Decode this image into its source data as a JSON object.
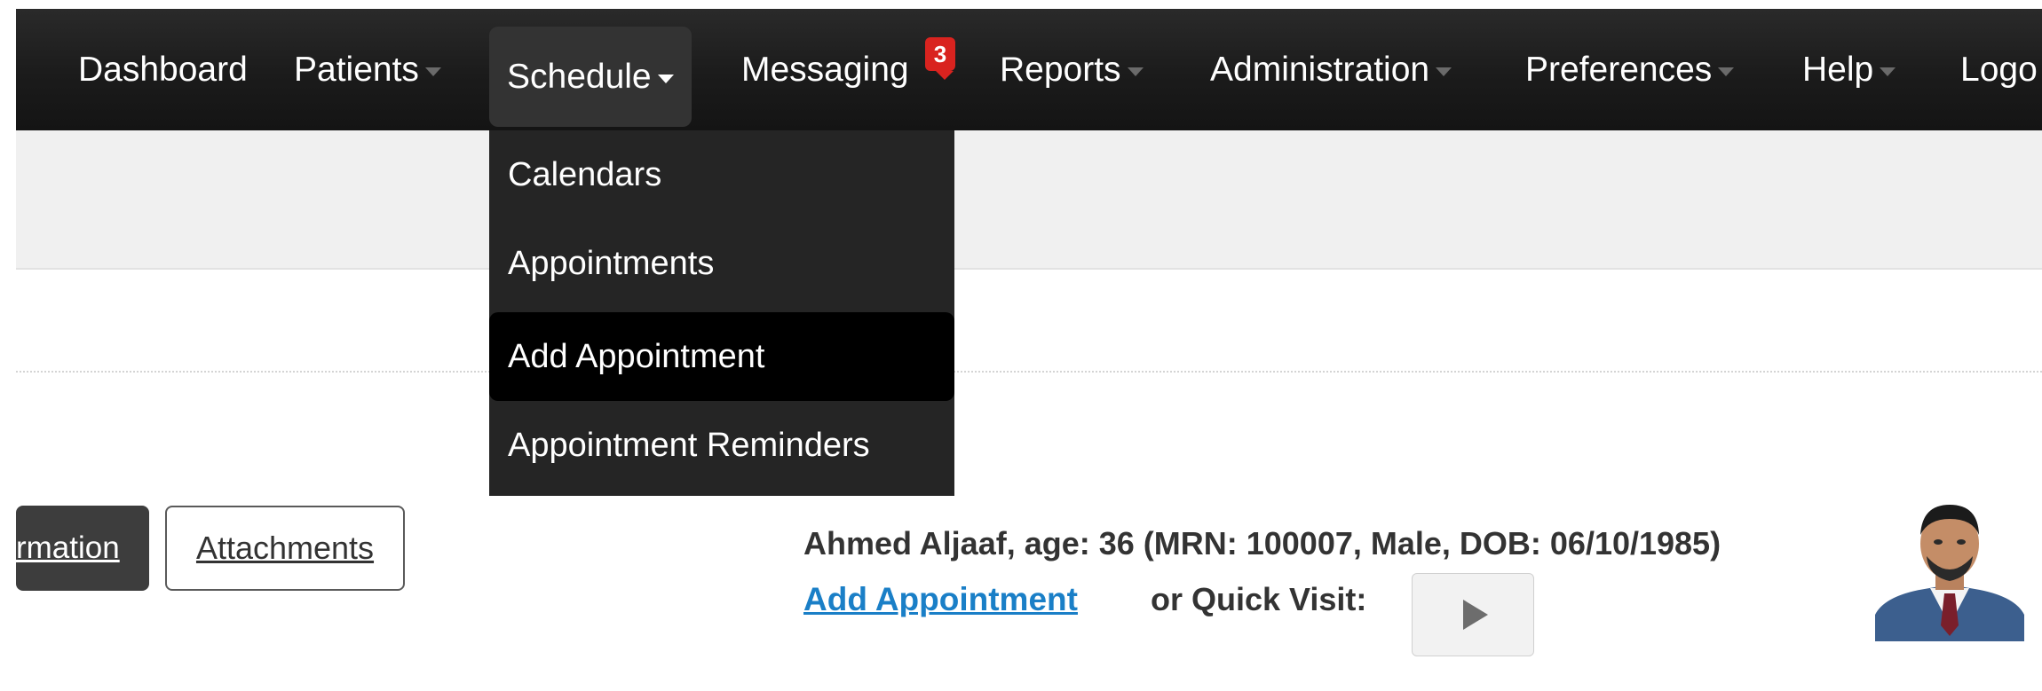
{
  "nav": {
    "items": [
      {
        "label": "Dashboard"
      },
      {
        "label": "Patients"
      },
      {
        "label": "Schedule"
      },
      {
        "label": "Messaging"
      },
      {
        "label": "Reports"
      },
      {
        "label": "Administration"
      },
      {
        "label": "Preferences"
      },
      {
        "label": "Help"
      },
      {
        "label": "Logo"
      }
    ],
    "messaging_badge": "3"
  },
  "schedule_menu": {
    "items": [
      {
        "label": "Calendars"
      },
      {
        "label": "Appointments"
      },
      {
        "label": "Add Appointment"
      },
      {
        "label": "Appointment Reminders"
      }
    ],
    "highlighted": "Add Appointment"
  },
  "tabs": {
    "information": "rmation",
    "attachments": "Attachments"
  },
  "patient": {
    "summary": "Ahmed Aljaaf, age: 36 (MRN: 100007, Male, DOB: 06/10/1985)",
    "add_appointment_link": "Add Appointment",
    "quick_visit_label": "or Quick Visit:"
  },
  "colors": {
    "navbar": "#1b1b1b",
    "badge": "#d9231f",
    "link": "#1a7fc7",
    "dropdown": "#252525"
  }
}
